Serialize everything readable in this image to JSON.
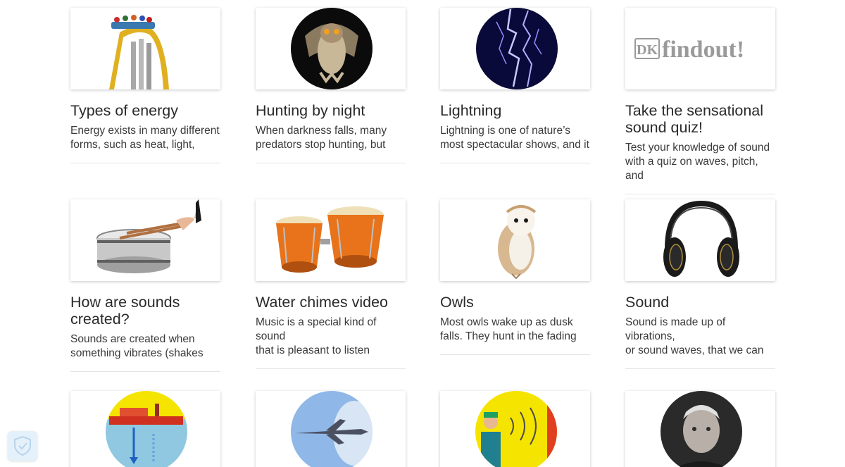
{
  "cards": [
    {
      "title": "Types of energy",
      "desc_line1": "Energy exists in many different",
      "desc_line2": "forms, such as heat, light,",
      "icon": "roller-coaster"
    },
    {
      "title": "Hunting by night",
      "desc_line1": "When darkness falls, many",
      "desc_line2": "predators stop hunting, but",
      "icon": "owl-night"
    },
    {
      "title": "Lightning",
      "desc_line1": "Lightning is one of nature’s",
      "desc_line2": "most spectacular shows, and it",
      "icon": "lightning"
    },
    {
      "title_line1": "Take the sensational",
      "title_line2": "sound quiz!",
      "desc_line1": "Test your knowledge of sound",
      "desc_line2": "with a quiz on waves, pitch, and",
      "icon": "dk-findout-logo",
      "logo_dk": "DK",
      "logo_text": "findout!"
    },
    {
      "title_line1": "How are sounds",
      "title_line2": "created?",
      "desc_line1": "Sounds are created when",
      "desc_line2": "something vibrates (shakes",
      "icon": "snare-drum"
    },
    {
      "title": "Water chimes video",
      "desc_line1": "Music is a special kind of sound",
      "desc_line2": "that is pleasant to listen",
      "icon": "bongo-drums"
    },
    {
      "title": "Owls",
      "desc_line1": "Most owls wake up as dusk",
      "desc_line2": "falls. They hunt in the fading",
      "icon": "barn-owl"
    },
    {
      "title": "Sound",
      "desc_line1": "Sound is made up of vibrations,",
      "desc_line2": "or sound waves, that we can",
      "icon": "headphones"
    },
    {
      "icon": "sonar-ship"
    },
    {
      "icon": "fighter-jet"
    },
    {
      "icon": "sound-waves-person"
    },
    {
      "icon": "portrait"
    }
  ],
  "colors": {
    "lightning_bg": "#0a0a3a",
    "bongo_orange": "#e8731a",
    "headphones": "#1a1a1a",
    "sonar_yellow": "#f5e400",
    "sky_blue": "#8fb8e8",
    "shield_bg": "#e4f1fb"
  },
  "privacy_button": {
    "icon": "shield-icon"
  }
}
